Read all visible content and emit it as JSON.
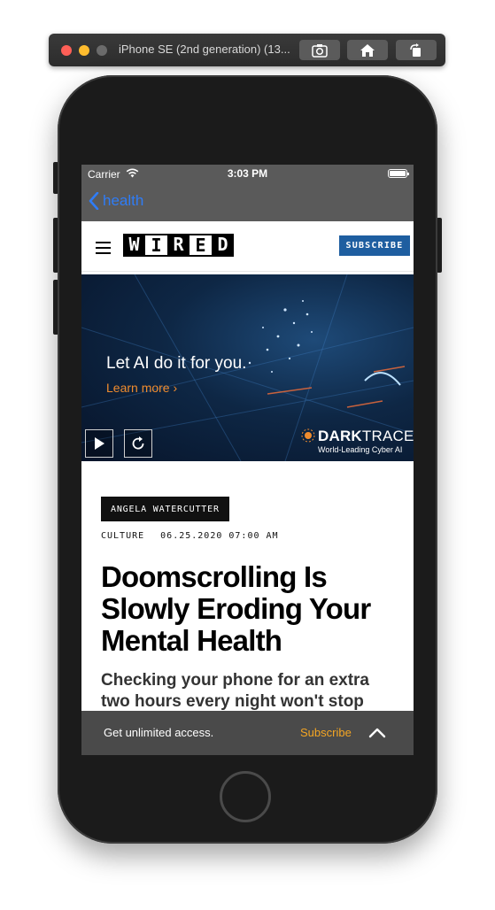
{
  "simulator": {
    "title": "iPhone SE (2nd generation) (13...",
    "buttons": [
      "screenshot-icon",
      "home-icon",
      "rotate-icon"
    ]
  },
  "status_bar": {
    "carrier": "Carrier",
    "time": "3:03 PM"
  },
  "nav": {
    "back_label": "health"
  },
  "header": {
    "logo_letters": [
      "W",
      "I",
      "R",
      "E",
      "D"
    ],
    "subscribe_label": "SUBSCRIBE"
  },
  "ad": {
    "headline": "Let AI do it for you.",
    "cta": "Learn more ›",
    "brand_bold": "DARK",
    "brand_light": "TRACE",
    "tagline": "World-Leading Cyber AI"
  },
  "article": {
    "author": "ANGELA WATERCUTTER",
    "category": "CULTURE",
    "date": "06.25.2020 07:00 AM",
    "headline": "Doomscrolling Is Slowly Eroding Your Mental Health",
    "dek": "Checking your phone for an extra two hours every night won't stop"
  },
  "access_bar": {
    "text": "Get unlimited access.",
    "subscribe": "Subscribe"
  },
  "colors": {
    "accent_blue": "#2f7cf6",
    "subscribe_blue": "#1e5ea0",
    "subscribe_orange": "#f5a623",
    "ad_orange": "#f08c2e"
  }
}
